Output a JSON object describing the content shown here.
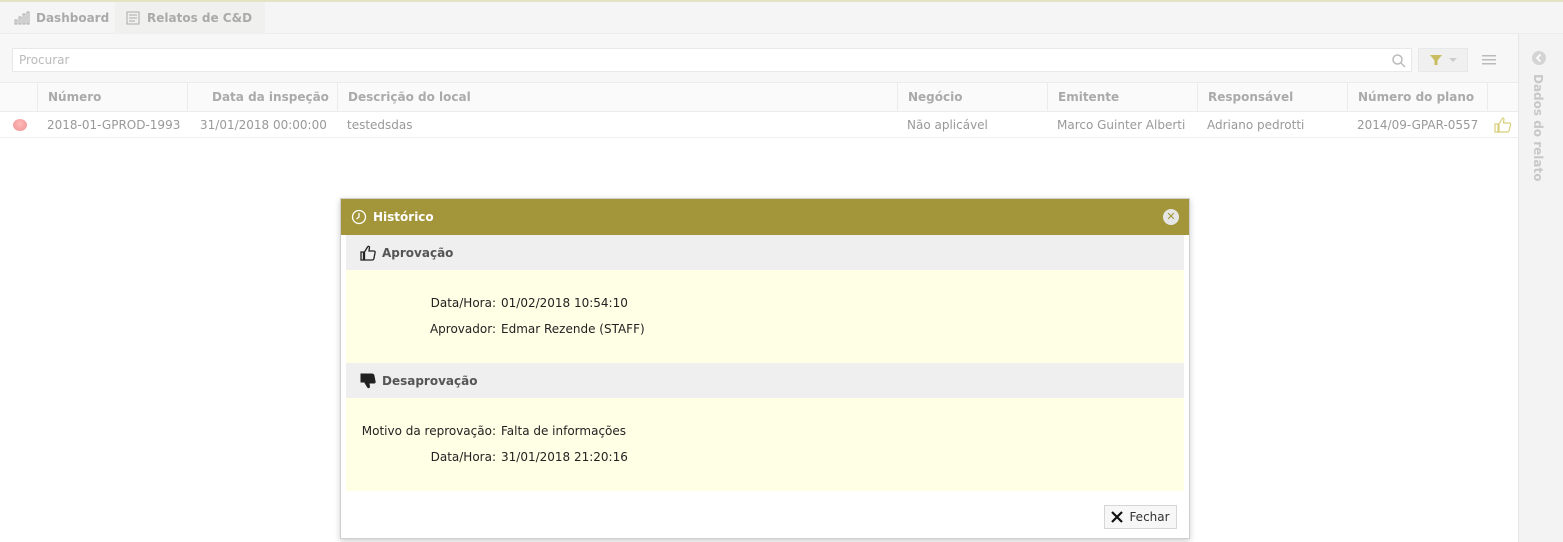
{
  "tabs": [
    {
      "label": "Dashboard"
    },
    {
      "label": "Relatos de C&D"
    }
  ],
  "search": {
    "placeholder": "Procurar",
    "value": ""
  },
  "grid": {
    "columns": [
      "Número",
      "Data da inspeção",
      "Descrição do local",
      "Negócio",
      "Emitente",
      "Responsável",
      "Número do plano"
    ],
    "rows": [
      {
        "numero": "2018-01-GPROD-1993",
        "data": "31/01/2018 00:00:00",
        "descricao": "testedsdas",
        "negocio": "Não aplicável",
        "emitente": "Marco Guinter Alberti",
        "responsavel": "Adriano pedrotti",
        "plano": "2014/09-GPAR-0557",
        "status_color": "#e24b4b"
      }
    ]
  },
  "side_panel": {
    "label": "Dados do relato"
  },
  "modal": {
    "title": "Histórico",
    "approval": {
      "title": "Aprovação",
      "fields": [
        {
          "key": "Data/Hora:",
          "value": "01/02/2018 10:54:10"
        },
        {
          "key": "Aprovador:",
          "value": "Edmar Rezende (STAFF)"
        }
      ]
    },
    "disapproval": {
      "title": "Desaprovação",
      "fields": [
        {
          "key": "Motivo da reprovação:",
          "value": "Falta de informações"
        },
        {
          "key": "Data/Hora:",
          "value": "31/01/2018 21:20:16"
        }
      ]
    },
    "close_button": "Fechar"
  },
  "colors": {
    "header_accent": "#a3963a",
    "section_bg": "#ffffe6"
  }
}
